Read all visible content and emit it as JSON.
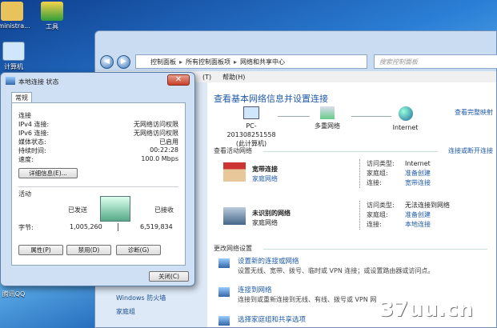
{
  "desktop": {
    "icons": [
      "dministra...",
      "工具",
      "计算机",
      "腾讯QQ"
    ]
  },
  "nc": {
    "address": [
      "控制面板",
      "所有控制面板项",
      "网络和共享中心"
    ],
    "search_placeholder": "搜索控制面板",
    "menu": [
      "(T)",
      "帮助(H)"
    ],
    "sidebar": [
      "Windows 防火墙",
      "家庭组"
    ],
    "title": "查看基本网络信息并设置连接",
    "full_map": "查看完整映射",
    "nodes": {
      "pc": "PC-201308251558",
      "pc_sub": "(此计算机)",
      "multi": "多重网络",
      "internet": "Internet"
    },
    "active_header": "查看活动网络",
    "connect_or_disconnect": "连接或断开连接",
    "net1": {
      "name": "宽带连接",
      "type": "家庭网络",
      "access_label": "访问类型:",
      "access": "Internet",
      "home_label": "家庭组:",
      "home": "准备创建",
      "conn_label": "连接:",
      "conn": "宽带连接"
    },
    "net2": {
      "name": "未识别的网络",
      "type": "家庭网络",
      "access_label": "访问类型:",
      "access": "无法连接到网络",
      "home_label": "家庭组:",
      "home": "准备创建",
      "conn_label": "连接:",
      "conn": "本地连接"
    },
    "change_header": "更改网络设置",
    "tasks": [
      {
        "title": "设置新的连接或网络",
        "desc": "设置无线、宽带、拨号、临时或 VPN 连接；或设置路由器或访问点。"
      },
      {
        "title": "连接到网络",
        "desc": "连接到或重新连接到无线、有线、拨号或 VPN 网"
      },
      {
        "title": "选择家庭组和共享选项",
        "desc": ""
      }
    ]
  },
  "dlg": {
    "title": "本地连接 状态",
    "tab": "常规",
    "conn_header": "连接",
    "rows": [
      {
        "k": "IPv4 连接:",
        "v": "无网络访问权限"
      },
      {
        "k": "IPv6 连接:",
        "v": "无网络访问权限"
      },
      {
        "k": "媒体状态:",
        "v": "已启用"
      },
      {
        "k": "持续时间:",
        "v": "00:22:28"
      },
      {
        "k": "速度:",
        "v": "100.0 Mbps"
      }
    ],
    "details_btn": "详细信息(E)...",
    "activity_header": "活动",
    "sent_label": "已发送",
    "recv_label": "已接收",
    "bytes_label": "字节:",
    "bytes_sent": "1,005,260",
    "bytes_recv": "6,519,834",
    "btn_props": "属性(P)",
    "btn_disable": "禁用(D)",
    "btn_diag": "诊断(G)",
    "btn_close": "关闭(C)"
  },
  "watermark": "37uu.cn"
}
